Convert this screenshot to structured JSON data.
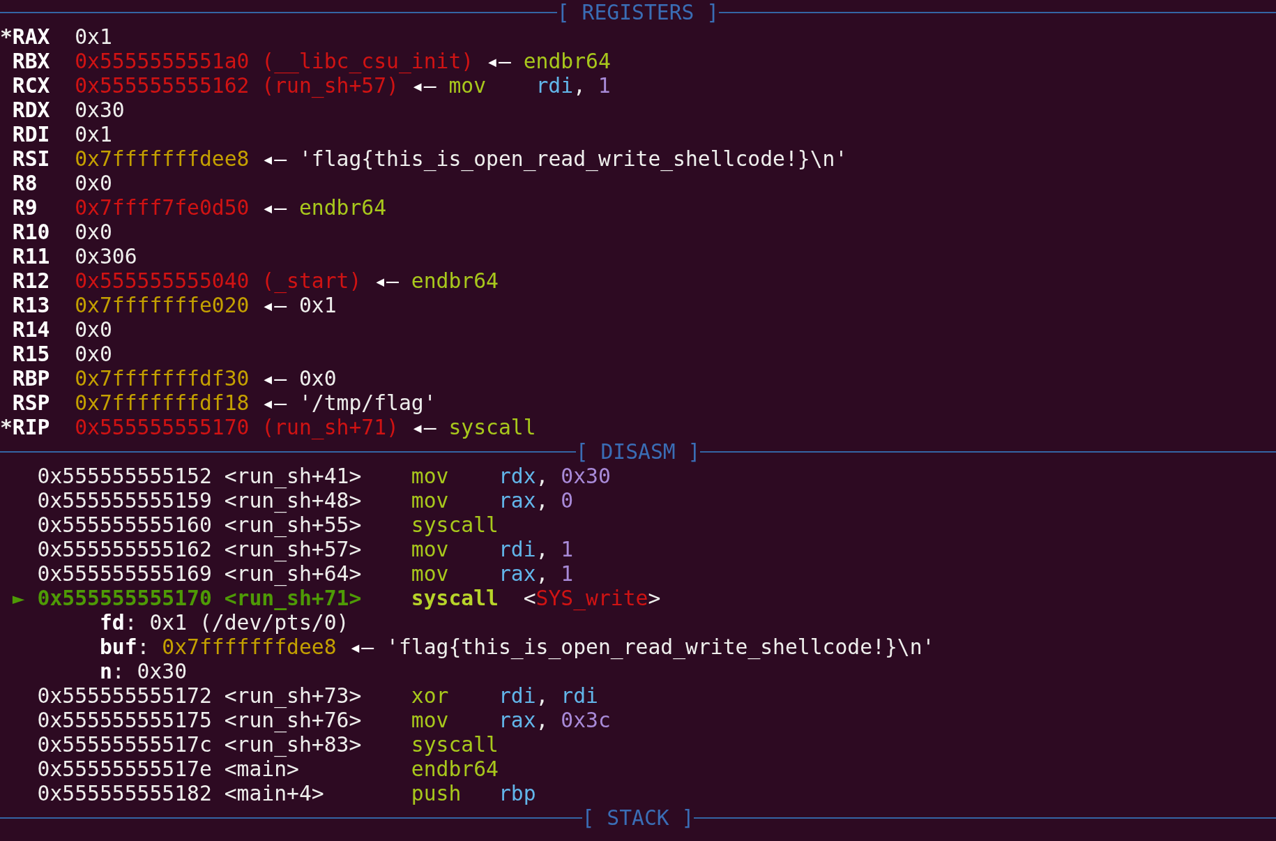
{
  "sections": [
    {
      "title": "[ REGISTERS ]",
      "kind": "registers",
      "rows": [
        {
          "marker": "*",
          "name": "RAX",
          "parts": [
            {
              "kind": "plain",
              "text": "0x1"
            }
          ]
        },
        {
          "name": "RBX",
          "parts": [
            {
              "kind": "code",
              "text": "0x5555555551a0"
            },
            {
              "kind": "sym",
              "text": "(__libc_csu_init)"
            },
            {
              "kind": "arrow",
              "text": "◂—"
            },
            {
              "kind": "insn",
              "text": "endbr64"
            }
          ]
        },
        {
          "name": "RCX",
          "parts": [
            {
              "kind": "code",
              "text": "0x555555555162"
            },
            {
              "kind": "sym",
              "text": "(run_sh+57)"
            },
            {
              "kind": "arrow",
              "text": "◂—"
            },
            {
              "kind": "insn",
              "text": "mov"
            },
            {
              "kind": "reg",
              "text": "rdi"
            },
            {
              "kind": "punct",
              "text": ","
            },
            {
              "kind": "num",
              "text": "1"
            }
          ]
        },
        {
          "name": "RDX",
          "parts": [
            {
              "kind": "plain",
              "text": "0x30"
            }
          ]
        },
        {
          "name": "RDI",
          "parts": [
            {
              "kind": "plain",
              "text": "0x1"
            }
          ]
        },
        {
          "name": "RSI",
          "parts": [
            {
              "kind": "stack",
              "text": "0x7fffffffdee8"
            },
            {
              "kind": "arrow",
              "text": "◂—"
            },
            {
              "kind": "string",
              "text": "'flag{this_is_open_read_write_shellcode!}\\n'"
            }
          ]
        },
        {
          "name": "R8",
          "parts": [
            {
              "kind": "plain",
              "text": "0x0"
            }
          ]
        },
        {
          "name": "R9",
          "parts": [
            {
              "kind": "code",
              "text": "0x7ffff7fe0d50"
            },
            {
              "kind": "arrow",
              "text": "◂—"
            },
            {
              "kind": "insn",
              "text": "endbr64"
            }
          ]
        },
        {
          "name": "R10",
          "parts": [
            {
              "kind": "plain",
              "text": "0x0"
            }
          ]
        },
        {
          "name": "R11",
          "parts": [
            {
              "kind": "plain",
              "text": "0x306"
            }
          ]
        },
        {
          "name": "R12",
          "parts": [
            {
              "kind": "code",
              "text": "0x555555555040"
            },
            {
              "kind": "sym",
              "text": "(_start)"
            },
            {
              "kind": "arrow",
              "text": "◂—"
            },
            {
              "kind": "insn",
              "text": "endbr64"
            }
          ]
        },
        {
          "name": "R13",
          "parts": [
            {
              "kind": "stack",
              "text": "0x7fffffffe020"
            },
            {
              "kind": "arrow",
              "text": "◂—"
            },
            {
              "kind": "plain",
              "text": "0x1"
            }
          ]
        },
        {
          "name": "R14",
          "parts": [
            {
              "kind": "plain",
              "text": "0x0"
            }
          ]
        },
        {
          "name": "R15",
          "parts": [
            {
              "kind": "plain",
              "text": "0x0"
            }
          ]
        },
        {
          "name": "RBP",
          "parts": [
            {
              "kind": "stack",
              "text": "0x7fffffffdf30"
            },
            {
              "kind": "arrow",
              "text": "◂—"
            },
            {
              "kind": "plain",
              "text": "0x0"
            }
          ]
        },
        {
          "name": "RSP",
          "parts": [
            {
              "kind": "stack",
              "text": "0x7fffffffdf18"
            },
            {
              "kind": "arrow",
              "text": "◂—"
            },
            {
              "kind": "string",
              "text": "'/tmp/flag'"
            }
          ]
        },
        {
          "marker": "*",
          "name": "RIP",
          "parts": [
            {
              "kind": "code",
              "text": "0x555555555170"
            },
            {
              "kind": "sym",
              "text": "(run_sh+71)"
            },
            {
              "kind": "arrow",
              "text": "◂—"
            },
            {
              "kind": "insn",
              "text": "syscall"
            }
          ]
        }
      ]
    },
    {
      "title": "[ DISASM ]",
      "kind": "disasm",
      "rows": [
        {
          "kind": "insn",
          "current": false,
          "address": "0x555555555152",
          "symbol": "<run_sh+41>",
          "mnemonic": "mov",
          "operands": [
            {
              "kind": "reg",
              "text": "rdx"
            },
            {
              "kind": "punct",
              "text": ","
            },
            {
              "kind": "num",
              "text": "0x30"
            }
          ]
        },
        {
          "kind": "insn",
          "current": false,
          "address": "0x555555555159",
          "symbol": "<run_sh+48>",
          "mnemonic": "mov",
          "operands": [
            {
              "kind": "reg",
              "text": "rax"
            },
            {
              "kind": "punct",
              "text": ","
            },
            {
              "kind": "num",
              "text": "0"
            }
          ]
        },
        {
          "kind": "insn",
          "current": false,
          "address": "0x555555555160",
          "symbol": "<run_sh+55>",
          "mnemonic": "syscall"
        },
        {
          "kind": "insn",
          "current": false,
          "address": "0x555555555162",
          "symbol": "<run_sh+57>",
          "mnemonic": "mov",
          "operands": [
            {
              "kind": "reg",
              "text": "rdi"
            },
            {
              "kind": "punct",
              "text": ","
            },
            {
              "kind": "num",
              "text": "1"
            }
          ]
        },
        {
          "kind": "insn",
          "current": false,
          "address": "0x555555555169",
          "symbol": "<run_sh+64>",
          "mnemonic": "mov",
          "operands": [
            {
              "kind": "reg",
              "text": "rax"
            },
            {
              "kind": "punct",
              "text": ","
            },
            {
              "kind": "num",
              "text": "1"
            }
          ]
        },
        {
          "kind": "insn",
          "current": true,
          "marker": "►",
          "address": "0x555555555170",
          "symbol": "<run_sh+71>",
          "mnemonic": "syscall",
          "annotation": [
            {
              "kind": "punct",
              "text": "<"
            },
            {
              "kind": "code",
              "text": "SYS_write"
            },
            {
              "kind": "punct",
              "text": ">"
            }
          ]
        },
        {
          "kind": "arg",
          "name": "fd",
          "parts": [
            {
              "kind": "punct",
              "text": ":"
            },
            {
              "kind": "plain",
              "text": "0x1"
            },
            {
              "kind": "plain",
              "text": "(/dev/pts/0)"
            }
          ]
        },
        {
          "kind": "arg",
          "name": "buf",
          "parts": [
            {
              "kind": "punct",
              "text": ":"
            },
            {
              "kind": "stack",
              "text": "0x7fffffffdee8"
            },
            {
              "kind": "arrow",
              "text": "◂—"
            },
            {
              "kind": "string",
              "text": "'flag{this_is_open_read_write_shellcode!}\\n'"
            }
          ]
        },
        {
          "kind": "arg",
          "name": "n",
          "parts": [
            {
              "kind": "punct",
              "text": ":"
            },
            {
              "kind": "plain",
              "text": "0x30"
            }
          ]
        },
        {
          "kind": "insn",
          "current": false,
          "address": "0x555555555172",
          "symbol": "<run_sh+73>",
          "mnemonic": "xor",
          "operands": [
            {
              "kind": "reg",
              "text": "rdi"
            },
            {
              "kind": "punct",
              "text": ","
            },
            {
              "kind": "reg",
              "text": "rdi"
            }
          ]
        },
        {
          "kind": "insn",
          "current": false,
          "address": "0x555555555175",
          "symbol": "<run_sh+76>",
          "mnemonic": "mov",
          "operands": [
            {
              "kind": "reg",
              "text": "rax"
            },
            {
              "kind": "punct",
              "text": ","
            },
            {
              "kind": "num",
              "text": "0x3c"
            }
          ]
        },
        {
          "kind": "insn",
          "current": false,
          "address": "0x55555555517c",
          "symbol": "<run_sh+83>",
          "mnemonic": "syscall"
        },
        {
          "kind": "insn",
          "current": false,
          "address": "0x55555555517e",
          "symbol": "<main>",
          "mnemonic": "endbr64"
        },
        {
          "kind": "insn",
          "current": false,
          "address": "0x555555555182",
          "symbol": "<main+4>",
          "mnemonic": "push",
          "operands": [
            {
              "kind": "reg",
              "text": "rbp"
            }
          ]
        }
      ]
    },
    {
      "title": "[ STACK ]"
    }
  ]
}
